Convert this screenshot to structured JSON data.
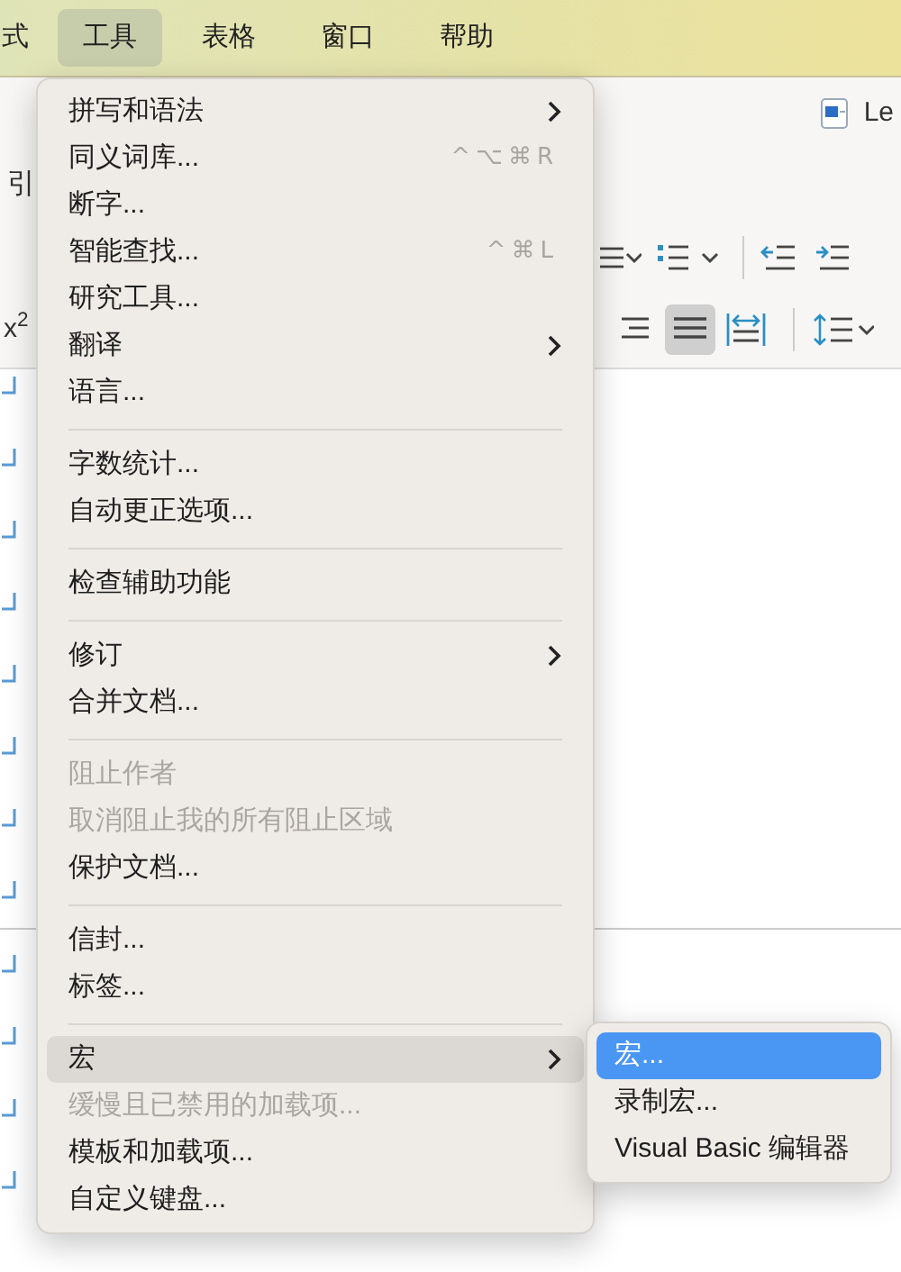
{
  "menubar": [
    {
      "label": "式",
      "selected": false
    },
    {
      "label": "工具",
      "selected": true
    },
    {
      "label": "表格",
      "selected": false
    },
    {
      "label": "窗口",
      "selected": false
    },
    {
      "label": "帮助",
      "selected": false
    }
  ],
  "ribbon": {
    "document_title": "Le",
    "tab_label": "引",
    "superscript_button": "x$^{2}$",
    "alignment_buttons": [
      {
        "kind": "align-right",
        "selected": false
      },
      {
        "kind": "justify",
        "selected": true
      },
      {
        "kind": "distribute",
        "selected": false
      }
    ]
  },
  "menu": {
    "items": [
      {
        "kind": "item",
        "label": "拼写和语法",
        "submenu": true,
        "disabled": false,
        "selected": false
      },
      {
        "kind": "item",
        "label": "同义词库...",
        "shortcut": "^⌥⌘R",
        "submenu": false,
        "disabled": false,
        "selected": false
      },
      {
        "kind": "item",
        "label": "断字...",
        "submenu": false,
        "disabled": false,
        "selected": false
      },
      {
        "kind": "item",
        "label": "智能查找...",
        "shortcut": "^⌘L",
        "submenu": false,
        "disabled": false,
        "selected": false
      },
      {
        "kind": "item",
        "label": "研究工具...",
        "submenu": false,
        "disabled": false,
        "selected": false
      },
      {
        "kind": "item",
        "label": "翻译",
        "submenu": true,
        "disabled": false,
        "selected": false
      },
      {
        "kind": "item",
        "label": "语言...",
        "submenu": false,
        "disabled": false,
        "selected": false
      },
      {
        "kind": "separator"
      },
      {
        "kind": "item",
        "label": "字数统计...",
        "submenu": false,
        "disabled": false,
        "selected": false
      },
      {
        "kind": "item",
        "label": "自动更正选项...",
        "submenu": false,
        "disabled": false,
        "selected": false
      },
      {
        "kind": "separator"
      },
      {
        "kind": "item",
        "label": "检查辅助功能",
        "submenu": false,
        "disabled": false,
        "selected": false
      },
      {
        "kind": "separator"
      },
      {
        "kind": "item",
        "label": "修订",
        "submenu": true,
        "disabled": false,
        "selected": false
      },
      {
        "kind": "item",
        "label": "合并文档...",
        "submenu": false,
        "disabled": false,
        "selected": false
      },
      {
        "kind": "separator"
      },
      {
        "kind": "item",
        "label": "阻止作者",
        "submenu": false,
        "disabled": true,
        "selected": false
      },
      {
        "kind": "item",
        "label": "取消阻止我的所有阻止区域",
        "submenu": false,
        "disabled": true,
        "selected": false
      },
      {
        "kind": "item",
        "label": "保护文档...",
        "submenu": false,
        "disabled": false,
        "selected": false
      },
      {
        "kind": "separator"
      },
      {
        "kind": "item",
        "label": "信封...",
        "submenu": false,
        "disabled": false,
        "selected": false
      },
      {
        "kind": "item",
        "label": "标签...",
        "submenu": false,
        "disabled": false,
        "selected": false
      },
      {
        "kind": "separator"
      },
      {
        "kind": "item",
        "label": "宏",
        "submenu": true,
        "disabled": false,
        "selected": true
      },
      {
        "kind": "item",
        "label": "缓慢且已禁用的加载项...",
        "submenu": false,
        "disabled": true,
        "selected": false
      },
      {
        "kind": "item",
        "label": "模板和加载项...",
        "submenu": false,
        "disabled": false,
        "selected": false
      },
      {
        "kind": "item",
        "label": "自定义键盘...",
        "submenu": false,
        "disabled": false,
        "selected": false
      }
    ]
  },
  "submenu": {
    "items": [
      {
        "label": "宏...",
        "selected": true
      },
      {
        "label": "录制宏...",
        "selected": false
      },
      {
        "label": "Visual Basic 编辑器",
        "selected": false
      }
    ]
  }
}
